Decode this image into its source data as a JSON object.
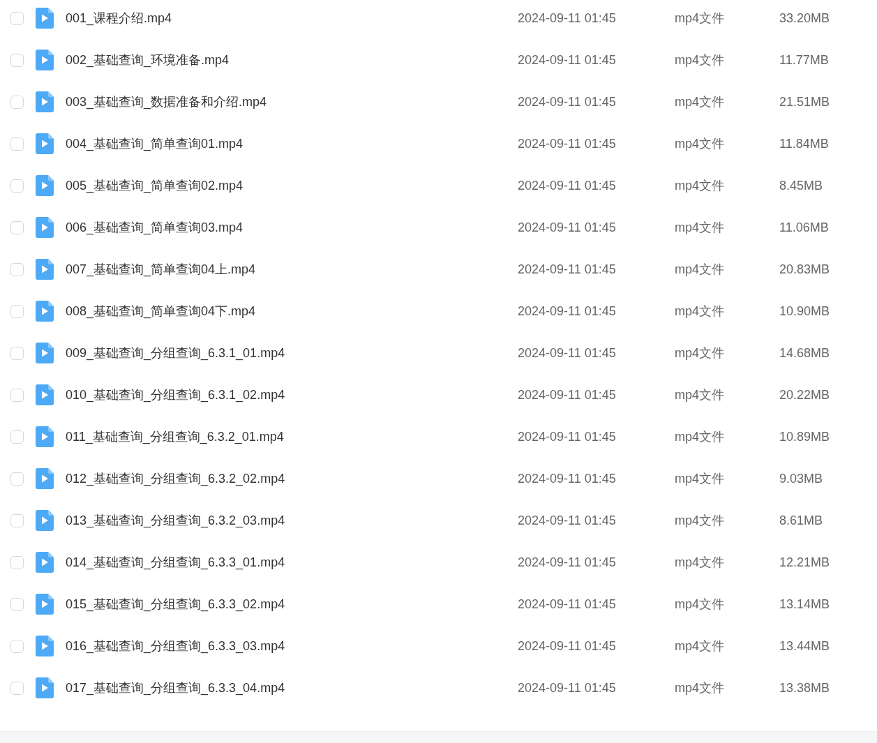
{
  "files": [
    {
      "name": "001_课程介绍.mp4",
      "date": "2024-09-11 01:45",
      "type": "mp4文件",
      "size": "33.20MB",
      "checked": false
    },
    {
      "name": "002_基础查询_环境准备.mp4",
      "date": "2024-09-11 01:45",
      "type": "mp4文件",
      "size": "11.77MB",
      "checked": false
    },
    {
      "name": "003_基础查询_数据准备和介绍.mp4",
      "date": "2024-09-11 01:45",
      "type": "mp4文件",
      "size": "21.51MB",
      "checked": false
    },
    {
      "name": "004_基础查询_简单查询01.mp4",
      "date": "2024-09-11 01:45",
      "type": "mp4文件",
      "size": "11.84MB",
      "checked": false
    },
    {
      "name": "005_基础查询_简单查询02.mp4",
      "date": "2024-09-11 01:45",
      "type": "mp4文件",
      "size": "8.45MB",
      "checked": false
    },
    {
      "name": "006_基础查询_简单查询03.mp4",
      "date": "2024-09-11 01:45",
      "type": "mp4文件",
      "size": "11.06MB",
      "checked": false
    },
    {
      "name": "007_基础查询_简单查询04上.mp4",
      "date": "2024-09-11 01:45",
      "type": "mp4文件",
      "size": "20.83MB",
      "checked": false
    },
    {
      "name": "008_基础查询_简单查询04下.mp4",
      "date": "2024-09-11 01:45",
      "type": "mp4文件",
      "size": "10.90MB",
      "checked": false
    },
    {
      "name": "009_基础查询_分组查询_6.3.1_01.mp4",
      "date": "2024-09-11 01:45",
      "type": "mp4文件",
      "size": "14.68MB",
      "checked": false
    },
    {
      "name": "010_基础查询_分组查询_6.3.1_02.mp4",
      "date": "2024-09-11 01:45",
      "type": "mp4文件",
      "size": "20.22MB",
      "checked": false
    },
    {
      "name": "011_基础查询_分组查询_6.3.2_01.mp4",
      "date": "2024-09-11 01:45",
      "type": "mp4文件",
      "size": "10.89MB",
      "checked": false
    },
    {
      "name": "012_基础查询_分组查询_6.3.2_02.mp4",
      "date": "2024-09-11 01:45",
      "type": "mp4文件",
      "size": "9.03MB",
      "checked": false
    },
    {
      "name": "013_基础查询_分组查询_6.3.2_03.mp4",
      "date": "2024-09-11 01:45",
      "type": "mp4文件",
      "size": "8.61MB",
      "checked": false
    },
    {
      "name": "014_基础查询_分组查询_6.3.3_01.mp4",
      "date": "2024-09-11 01:45",
      "type": "mp4文件",
      "size": "12.21MB",
      "checked": false
    },
    {
      "name": "015_基础查询_分组查询_6.3.3_02.mp4",
      "date": "2024-09-11 01:45",
      "type": "mp4文件",
      "size": "13.14MB",
      "checked": false
    },
    {
      "name": "016_基础查询_分组查询_6.3.3_03.mp4",
      "date": "2024-09-11 01:45",
      "type": "mp4文件",
      "size": "13.44MB",
      "checked": false
    },
    {
      "name": "017_基础查询_分组查询_6.3.3_04.mp4",
      "date": "2024-09-11 01:45",
      "type": "mp4文件",
      "size": "13.38MB",
      "checked": false
    }
  ]
}
